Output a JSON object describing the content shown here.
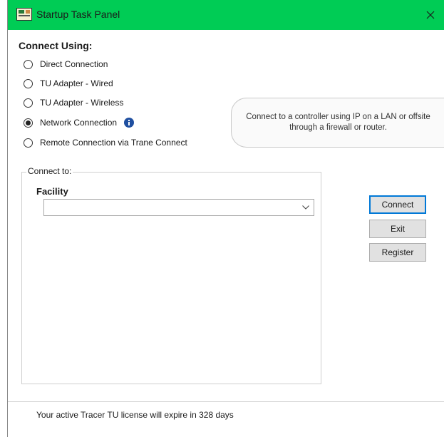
{
  "window": {
    "title": "Startup Task Panel",
    "title_bar_color": "#00cc55"
  },
  "connect_using": {
    "heading": "Connect Using:",
    "options": [
      {
        "label": "Direct Connection",
        "checked": false
      },
      {
        "label": "TU Adapter - Wired",
        "checked": false
      },
      {
        "label": "TU Adapter - Wireless",
        "checked": false
      },
      {
        "label": "Network Connection",
        "checked": true
      },
      {
        "label": "Remote Connection via Trane Connect",
        "checked": false
      }
    ]
  },
  "hint": {
    "text": "Connect to a controller using IP on a LAN or offsite through a firewall or router."
  },
  "connect_to": {
    "legend": "Connect to:",
    "facility_label": "Facility",
    "facility_value": ""
  },
  "buttons": {
    "connect": "Connect",
    "exit": "Exit",
    "register": "Register"
  },
  "status": {
    "text": "Your active Tracer TU license will expire in 328 days"
  },
  "icons": {
    "info": "info-icon",
    "close": "close-icon",
    "dropdown": "chevron-down-icon",
    "app": "app-icon"
  },
  "colors": {
    "info_icon": "#1f4fa0",
    "primary_button_border": "#0078d7"
  }
}
